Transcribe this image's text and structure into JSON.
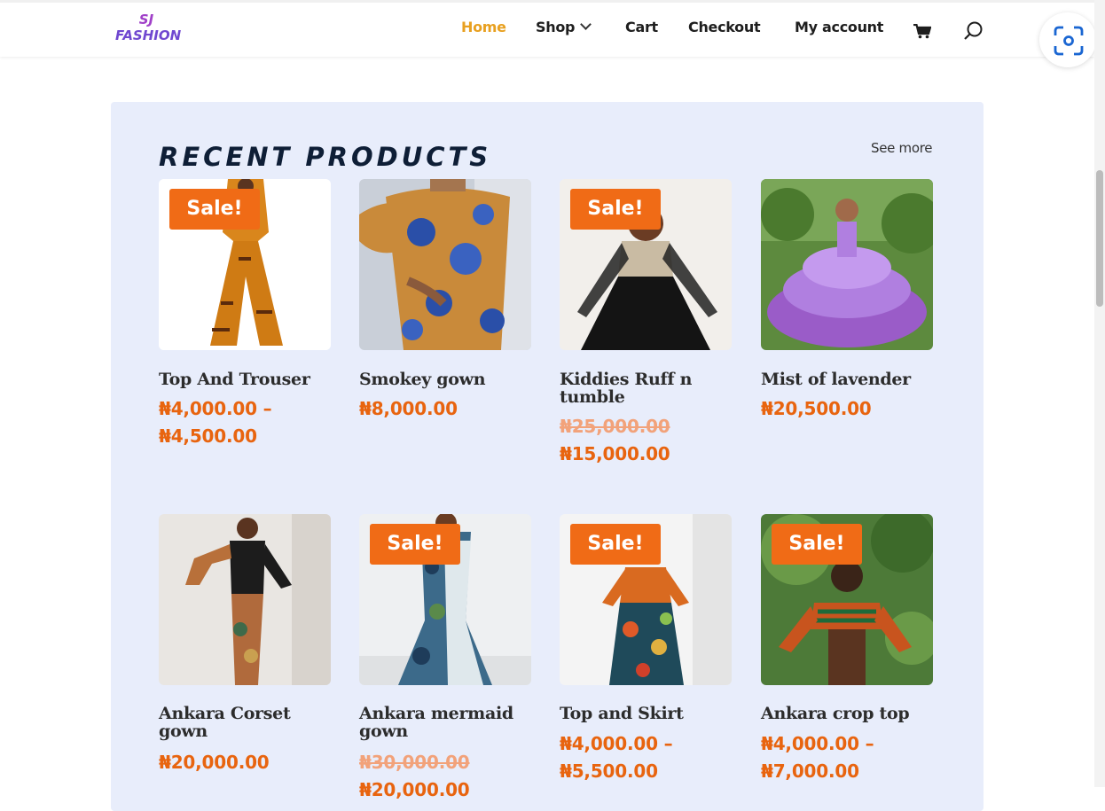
{
  "header": {
    "logo_line1": "SJ",
    "logo_line2": "FASHION",
    "nav": {
      "home": "Home",
      "shop": "Shop",
      "cart": "Cart",
      "checkout": "Checkout",
      "my_account": "My account"
    }
  },
  "section": {
    "title": "RECENT PRODUCTS",
    "see_more": "See more"
  },
  "sale_badge": "Sale!",
  "products": [
    {
      "name": "Top And Trouser",
      "price_line1": "₦4,000.00 –",
      "price_line2": "₦4,500.00",
      "sale": true
    },
    {
      "name": "Smokey gown",
      "price_line1": "₦8,000.00",
      "sale": false
    },
    {
      "name": "Kiddies Ruff n tumble",
      "price_old": "₦25,000.00",
      "price_line1": "₦15,000.00",
      "sale": true
    },
    {
      "name": "Mist of lavender",
      "price_line1": "₦20,500.00",
      "sale": false
    },
    {
      "name": "Ankara Corset gown",
      "price_line1": "₦20,000.00",
      "sale": false
    },
    {
      "name": "Ankara mermaid gown",
      "price_old": "₦30,000.00",
      "price_line1": "₦20,000.00",
      "sale": true
    },
    {
      "name": "Top and Skirt",
      "price_line1": "₦4,000.00 –",
      "price_line2": "₦5,500.00",
      "sale": true
    },
    {
      "name": "Ankara crop top",
      "price_line1": "₦4,000.00 –",
      "price_line2": "₦7,000.00",
      "sale": true
    }
  ],
  "colors": {
    "accent_orange": "#f06b16",
    "price_orange": "#e8640f",
    "nav_active": "#e8a020",
    "panel_bg": "#e8edfb"
  },
  "icons": {
    "cart": "cart-icon",
    "search": "search-icon",
    "lens": "lens-icon"
  }
}
